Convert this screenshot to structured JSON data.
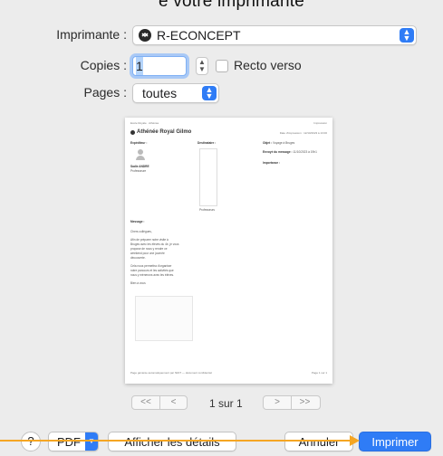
{
  "header": {
    "title_fragment": "e votre imprimante"
  },
  "printer": {
    "label": "Imprimante :",
    "value": "R-ECONCEPT"
  },
  "copies": {
    "label": "Copies :",
    "value": "1",
    "duplex_label": "Recto verso"
  },
  "pages": {
    "label": "Pages :",
    "value": "toutes"
  },
  "preview": {
    "top_left": "Ecole Royale · Athénée",
    "top_right": "Impression",
    "school_title": "Athénée Royal Gilmo",
    "date_line": "Date d'impression : 12/10/2023 à 13:00",
    "col_sender": "Expéditeur :",
    "col_recipient": "Destinataire :",
    "subject_label": "Objet :",
    "subject_value": "Voyage à Bruges",
    "sent_label": "Envoyé du message :",
    "sent_value": "11/10/2023 à 19h1",
    "importance_label": "Importance :",
    "sender_name": "Sadie ANDRE",
    "sender_role": "Professeure",
    "recipient_role": "Professeurs",
    "message_label": "Message :",
    "message_lines": [
      "Chers collègues,",
      "Afin de préparer notre visite à",
      "Bruges avec les élèves du 4e, je vous",
      "propose de nous y rendre ce",
      "weekend pour une journée",
      "découverte.",
      "Cela nous permettra d'organiser",
      "notre parcours et les activités que",
      "nous y mènerons avec les élèves.",
      "Bien à vous"
    ],
    "footer_left": "Page générée automatiquement par l'ENT — document confidentiel",
    "footer_right": "Page 1 sur 1"
  },
  "pager": {
    "first": "<<",
    "prev": "<",
    "status": "1 sur 1",
    "next": ">",
    "last": ">>"
  },
  "footer": {
    "help": "?",
    "pdf": "PDF",
    "details": "Afficher les détails",
    "cancel": "Annuler",
    "print": "Imprimer"
  },
  "colors": {
    "accent": "#2f7cf6",
    "annotation": "#f5a623"
  }
}
